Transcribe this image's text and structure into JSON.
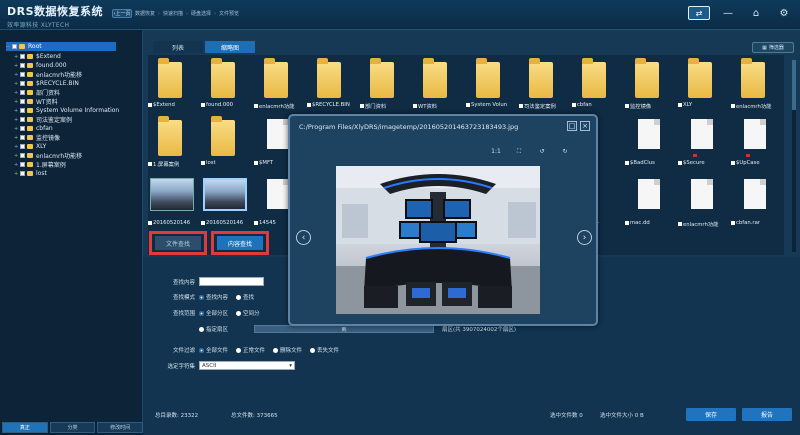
{
  "app": {
    "title": "DRS数据恢复系统",
    "subtitle": "效率源科技 XLYTECH"
  },
  "breadcrumb": {
    "back_label": "上一页",
    "items": [
      "数据恢复",
      "快速扫描",
      "硬盘选择",
      "文件预览"
    ]
  },
  "window_controls": {
    "active_icon": "restore-icon"
  },
  "tree": {
    "root": "Root",
    "items": [
      "$Extend",
      "found.000",
      "enlacmrh功能移",
      "$RECYCLE.BIN",
      "部门资料",
      "WT资料",
      "System Volume Information",
      "司法鉴定案例",
      "cbfan",
      "监控镜像",
      "XLY",
      "enlacmrh功能移",
      "1.屏幕案例",
      "lost"
    ]
  },
  "bottom_tabs": {
    "items": [
      "真正",
      "分类",
      "修改时间"
    ],
    "active_index": 0
  },
  "view_tabs": {
    "items": [
      "列表",
      "缩略图"
    ],
    "active_index": 1
  },
  "filter_button": "筛选器",
  "grid": {
    "row1": [
      "$Extend",
      "found.000",
      "enlacmrh功能",
      "$RECYCLE.BIN",
      "部门资料",
      "WT资料",
      "System Volun",
      "司法鉴定案例",
      "cbfan",
      "监控镜像",
      "XLY",
      "enlacmrh功能"
    ],
    "row2": [
      "1.屏幕案例",
      "lost",
      "$MFT",
      "",
      "",
      "",
      "",
      "",
      "$BadClus",
      "$Secure",
      "$UpCase",
      ""
    ],
    "row3": [
      "20160520146",
      "20160520146",
      "14545",
      "",
      "",
      "",
      "",
      "",
      "2-",
      "mac.dd",
      "enlacmrh功能",
      "cbfan.rar"
    ]
  },
  "search": {
    "tabs": [
      "文件查找",
      "内容查找"
    ],
    "active_tab": 1,
    "content_label": "查找内容",
    "mode_label": "查找模式",
    "mode_options": [
      "查找内容",
      "查找"
    ],
    "range_label": "查找范围",
    "range_options": [
      "全部分区",
      "空间分"
    ],
    "sector_option": "指定扇区",
    "sector_to": "到",
    "sector_info": "扇区(共 3907024002个扇区)",
    "filter_label": "文件过滤",
    "filter_options": [
      "全部文件",
      "正常文件",
      "删除文件",
      "丢失文件"
    ],
    "charset_label": "选定字符集",
    "charset_value": "ASCII"
  },
  "status": {
    "dirs": "总目录数: 23322",
    "files": "总文件数: 373665",
    "selected_count": "选中文件数 0",
    "selected_size": "选中文件大小 0 B",
    "save_button": "保存",
    "report_button": "报告"
  },
  "dialog": {
    "title": "C:/Program Files/XlyDRS/imagetemp/201605201463723183493.jpg",
    "zoom_label": "1:1"
  },
  "colors": {
    "accent": "#1e72ba",
    "highlight": "#e03a3a",
    "folder": "#f1c54f"
  }
}
